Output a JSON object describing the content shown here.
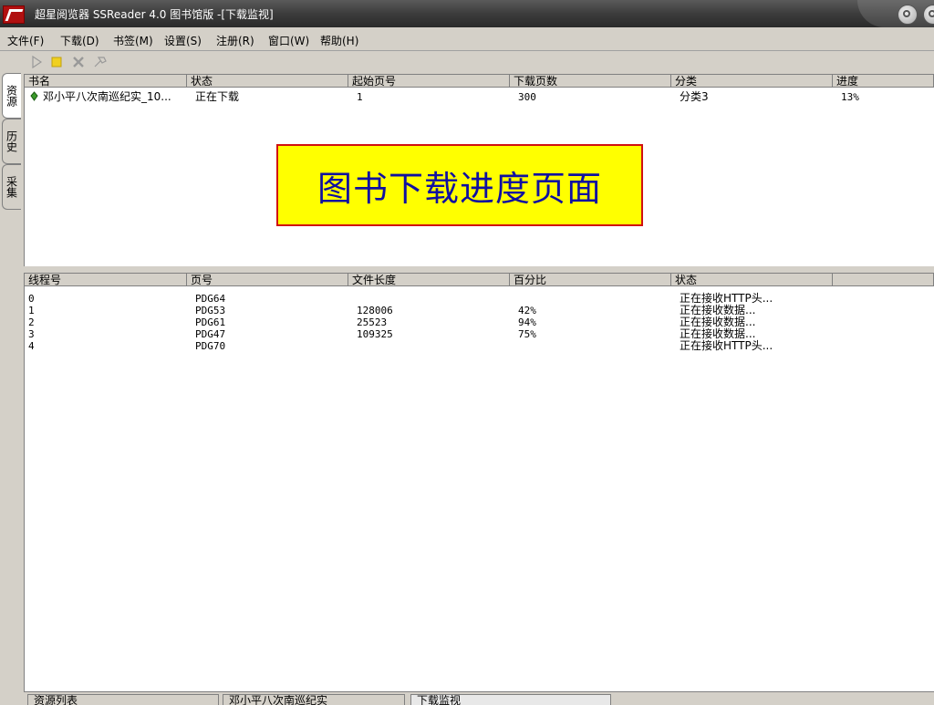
{
  "window": {
    "title": "超星阅览器 SSReader 4.0 图书馆版 -[下载监视]"
  },
  "menu": [
    "文件(F)",
    "下载(D)",
    "书签(M)",
    "设置(S)",
    "注册(R)",
    "窗口(W)",
    "帮助(H)"
  ],
  "toolbar": {
    "icons": [
      "play-icon",
      "stop-icon",
      "delete-icon",
      "settings-icon"
    ]
  },
  "side_tabs": [
    "资源",
    "历史",
    "采集"
  ],
  "books": {
    "columns": [
      "书名",
      "状态",
      "起始页号",
      "下载页数",
      "分类",
      "进度"
    ],
    "rows": [
      {
        "title": "邓小平八次南巡纪实_10...",
        "status": "正在下载",
        "start_page": "1",
        "pages": "300",
        "category": "分类3",
        "progress": "13%"
      }
    ]
  },
  "banner": "图书下载进度页面",
  "threads": {
    "columns": [
      "线程号",
      "页号",
      "文件长度",
      "百分比",
      "状态",
      ""
    ],
    "rows": [
      {
        "id": "0",
        "page": "PDG64",
        "length": "",
        "percent": "",
        "status": "正在接收HTTP头..."
      },
      {
        "id": "1",
        "page": "PDG53",
        "length": "128006",
        "percent": "42%",
        "status": "正在接收数据..."
      },
      {
        "id": "2",
        "page": "PDG61",
        "length": "25523",
        "percent": "94%",
        "status": "正在接收数据..."
      },
      {
        "id": "3",
        "page": "PDG47",
        "length": "109325",
        "percent": "75%",
        "status": "正在接收数据..."
      },
      {
        "id": "4",
        "page": "PDG70",
        "length": "",
        "percent": "",
        "status": "正在接收HTTP头..."
      }
    ]
  },
  "bottom_tabs": [
    "资源列表",
    "邓小平八次南巡纪实",
    "下载监视"
  ],
  "colors": {
    "banner_bg": "#ffff00",
    "banner_border": "#d01010",
    "banner_text": "#1010a0",
    "app_icon": "#b01010"
  }
}
